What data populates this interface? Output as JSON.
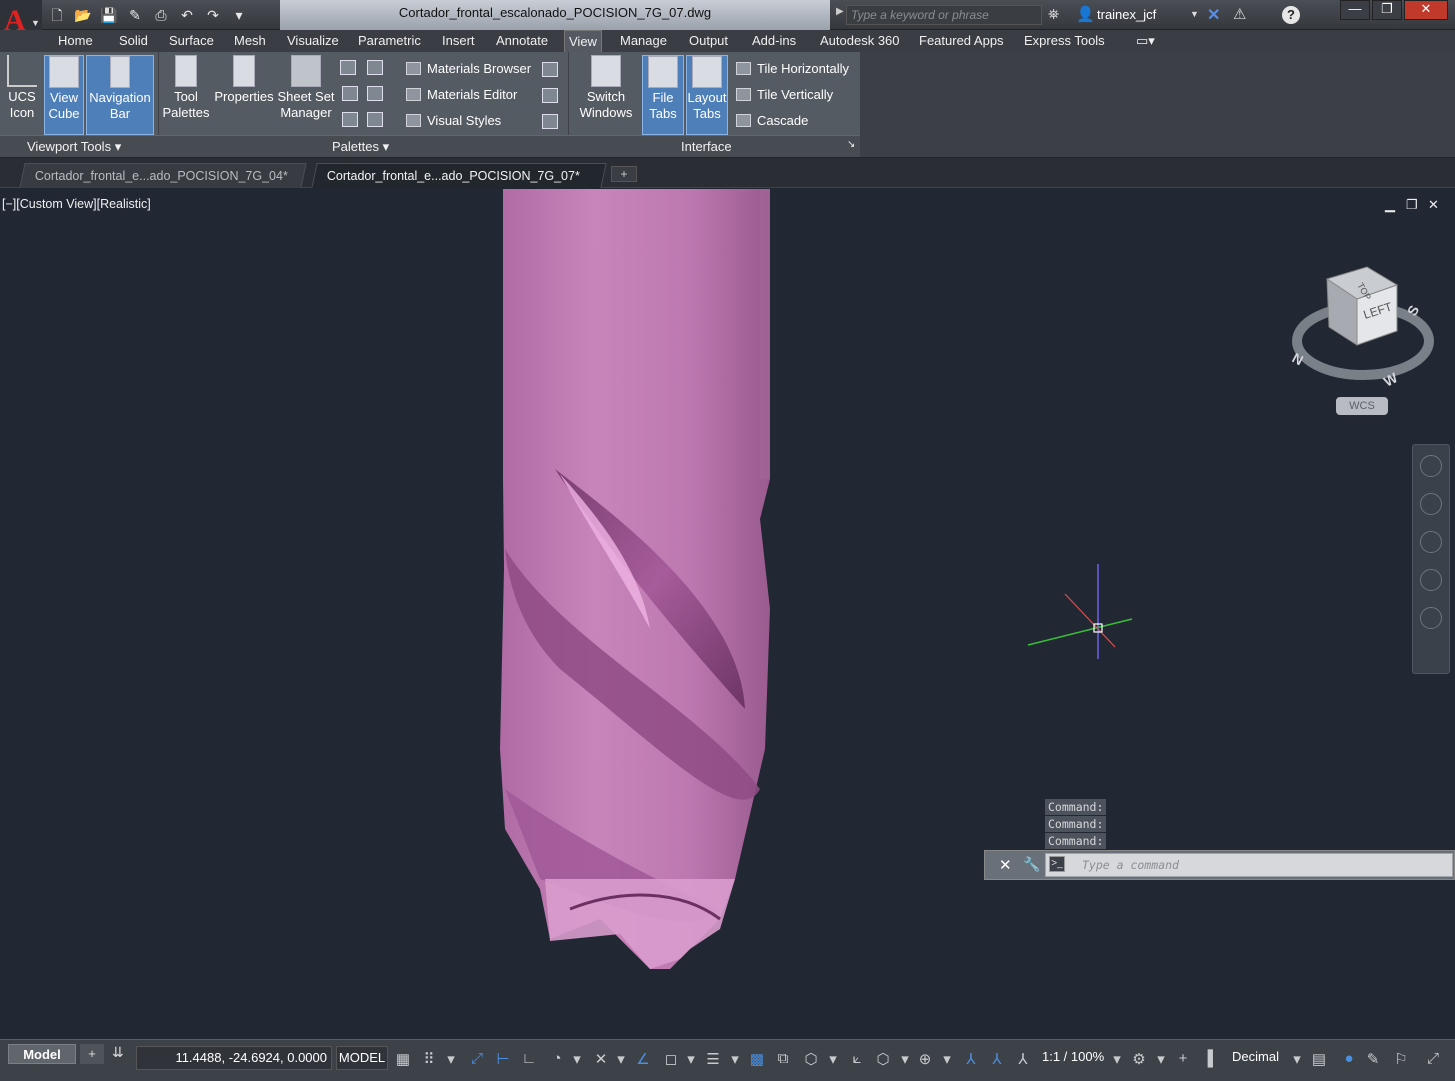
{
  "title_bar": {
    "document_title": "Cortador_frontal_escalonado_POCISION_7G_07.dwg",
    "search_placeholder": "Type a keyword or phrase",
    "user_name": "trainex_jcf",
    "help_glyph": "?",
    "app_logo_glyph": "A"
  },
  "ribbon_tabs": [
    "Home",
    "Solid",
    "Surface",
    "Mesh",
    "Visualize",
    "Parametric",
    "Insert",
    "Annotate",
    "View",
    "Manage",
    "Output",
    "Add-ins",
    "Autodesk 360",
    "Featured Apps",
    "Express Tools"
  ],
  "active_tab": "View",
  "ribbon": {
    "viewport_tools": {
      "label": "Viewport Tools",
      "buttons": [
        {
          "l1": "UCS",
          "l2": "Icon"
        },
        {
          "l1": "View",
          "l2": "Cube"
        },
        {
          "l1": "Navigation",
          "l2": "Bar"
        }
      ]
    },
    "palettes": {
      "label": "Palettes",
      "buttons": [
        {
          "l1": "Tool",
          "l2": "Palettes"
        },
        {
          "l1": "Properties",
          "l2": ""
        },
        {
          "l1": "Sheet Set",
          "l2": "Manager"
        }
      ],
      "small": [
        "Materials Browser",
        "Materials Editor",
        "Visual Styles"
      ]
    },
    "interface": {
      "label": "Interface",
      "buttons": [
        {
          "l1": "Switch",
          "l2": "Windows"
        },
        {
          "l1": "File",
          "l2": "Tabs"
        },
        {
          "l1": "Layout",
          "l2": "Tabs"
        }
      ],
      "small": [
        "Tile Horizontally",
        "Tile Vertically",
        "Cascade"
      ]
    }
  },
  "doc_tabs": [
    {
      "label": "Cortador_frontal_e...ado_POCISION_7G_04*",
      "active": false
    },
    {
      "label": "Cortador_frontal_e...ado_POCISION_7G_07*",
      "active": true
    }
  ],
  "viewport": {
    "label": "[−][Custom View][Realistic]",
    "viewcube": {
      "face": "LEFT",
      "top_face": "TOP",
      "compass": [
        "N",
        "W",
        "S"
      ],
      "wcs": "WCS"
    },
    "model_color": "#c27fb6"
  },
  "command_line": {
    "history": [
      "Command:",
      "Command:",
      "Command:"
    ],
    "placeholder": "Type a command"
  },
  "status_bar": {
    "model_tab": "Model",
    "coordinates": "11.4488, -24.6924, 0.0000",
    "space": "MODEL",
    "scale": "1:1 / 100%",
    "units": "Decimal"
  }
}
